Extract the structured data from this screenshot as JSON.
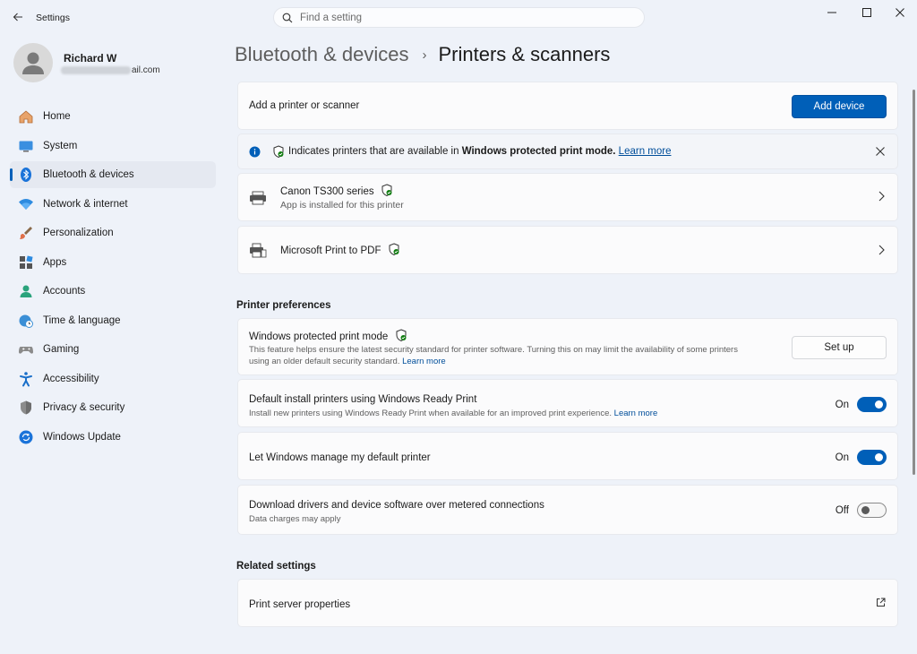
{
  "app": {
    "title": "Settings",
    "search_placeholder": "Find a setting"
  },
  "user": {
    "name": "Richard W",
    "email_visible": "ail.com"
  },
  "sidebar": {
    "items": [
      {
        "label": "Home",
        "icon": "home-icon"
      },
      {
        "label": "System",
        "icon": "system-icon"
      },
      {
        "label": "Bluetooth & devices",
        "icon": "bluetooth-icon",
        "active": true
      },
      {
        "label": "Network & internet",
        "icon": "network-icon"
      },
      {
        "label": "Personalization",
        "icon": "brush-icon"
      },
      {
        "label": "Apps",
        "icon": "apps-icon"
      },
      {
        "label": "Accounts",
        "icon": "accounts-icon"
      },
      {
        "label": "Time & language",
        "icon": "globe-clock-icon"
      },
      {
        "label": "Gaming",
        "icon": "gamepad-icon"
      },
      {
        "label": "Accessibility",
        "icon": "accessibility-icon"
      },
      {
        "label": "Privacy & security",
        "icon": "shield-icon"
      },
      {
        "label": "Windows Update",
        "icon": "update-icon"
      }
    ]
  },
  "breadcrumb": {
    "parent": "Bluetooth & devices",
    "separator": "›",
    "current": "Printers & scanners"
  },
  "add_printer": {
    "label": "Add a printer or scanner",
    "button": "Add device"
  },
  "info_bar": {
    "prefix": "Indicates printers that are available in",
    "bold": "Windows protected print mode.",
    "link": "Learn more"
  },
  "printers": [
    {
      "name": "Canon TS300 series",
      "subtitle": "App is installed for this printer"
    },
    {
      "name": "Microsoft Print to PDF",
      "subtitle": ""
    }
  ],
  "preferences": {
    "title": "Printer preferences",
    "protected_mode": {
      "title": "Windows protected print mode",
      "desc_line1": "This feature helps ensure the latest security standard for printer software. Turning this on may limit the availability of some printers",
      "desc_line2": "using an older default security standard.",
      "link": "Learn more",
      "button": "Set up"
    },
    "ready_print": {
      "title": "Default install printers using Windows Ready Print",
      "desc": "Install new printers using Windows Ready Print when available for an improved print experience.",
      "link": "Learn more",
      "state": "On"
    },
    "default_printer": {
      "title": "Let Windows manage my default printer",
      "state": "On"
    },
    "metered": {
      "title": "Download drivers and device software over metered connections",
      "desc": "Data charges may apply",
      "state": "Off"
    }
  },
  "related": {
    "title": "Related settings",
    "print_server": "Print server properties"
  },
  "colors": {
    "accent": "#005fb8",
    "background": "#eef2f9",
    "card": "#fbfbfc",
    "verified_green": "#0f7b0f"
  }
}
